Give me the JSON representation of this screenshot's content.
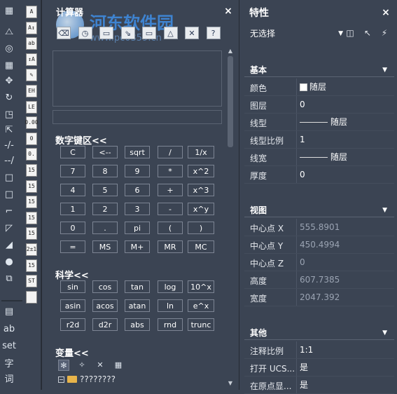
{
  "watermark": {
    "text": "河东软件园",
    "url": "www.pc0359.cn"
  },
  "toolbar_col1": [
    {
      "icon": "grid-icon",
      "glyph": "▦"
    },
    {
      "icon": "mirror-icon",
      "glyph": "⧍"
    },
    {
      "icon": "offset-icon",
      "glyph": "◎"
    },
    {
      "icon": "array-icon",
      "glyph": "▦"
    },
    {
      "icon": "move-icon",
      "glyph": "✥"
    },
    {
      "icon": "rotate-icon",
      "glyph": "↻"
    },
    {
      "icon": "scale-icon",
      "glyph": "◳"
    },
    {
      "icon": "stretch-icon",
      "glyph": "⇱"
    },
    {
      "icon": "trim-icon",
      "glyph": "-/-"
    },
    {
      "icon": "extend-icon",
      "glyph": "--/"
    },
    {
      "icon": "break-icon",
      "glyph": "□"
    },
    {
      "icon": "join-icon",
      "glyph": "□"
    },
    {
      "icon": "chamfer-icon",
      "glyph": "⌐"
    },
    {
      "icon": "fillet-icon",
      "glyph": "◸"
    },
    {
      "icon": "blend-icon",
      "glyph": "◢"
    },
    {
      "icon": "explode-icon",
      "glyph": "●"
    },
    {
      "icon": "edit-icon",
      "glyph": "⧉"
    },
    {
      "icon": "table-icon",
      "glyph": "▤"
    },
    {
      "icon": "ab-text-icon",
      "glyph": "ab"
    },
    {
      "icon": "set-icon",
      "glyph": "set"
    },
    {
      "icon": "zi-icon",
      "glyph": "字"
    },
    {
      "icon": "ci-icon",
      "glyph": "词"
    }
  ],
  "toolbar_col2": [
    {
      "icon": "text-a-icon",
      "glyph": "A"
    },
    {
      "icon": "text-a2-icon",
      "glyph": "A↕"
    },
    {
      "icon": "text-ab-icon",
      "glyph": "ab"
    },
    {
      "icon": "text-align-icon",
      "glyph": "↕A"
    },
    {
      "icon": "text-edit-icon",
      "glyph": "✎"
    },
    {
      "icon": "text-eh-icon",
      "glyph": "EH"
    },
    {
      "icon": "text-le-icon",
      "glyph": "LE"
    },
    {
      "icon": "dim-001-icon",
      "glyph": "0.00"
    },
    {
      "icon": "dim-0-icon",
      "glyph": "0"
    },
    {
      "icon": "dim-rot-icon",
      "glyph": "0."
    },
    {
      "icon": "dim-15-icon",
      "glyph": "15"
    },
    {
      "icon": "dim-15b-icon",
      "glyph": "15"
    },
    {
      "icon": "dim-15c-icon",
      "glyph": "15"
    },
    {
      "icon": "dim-15d-icon",
      "glyph": "15"
    },
    {
      "icon": "dim-15e-icon",
      "glyph": "15"
    },
    {
      "icon": "dim-21-icon",
      "glyph": "2±1"
    },
    {
      "icon": "dim-15f-icon",
      "glyph": "15"
    },
    {
      "icon": "dim-st-icon",
      "glyph": "ST"
    },
    {
      "icon": "tb2-blank-icon",
      "glyph": ""
    }
  ],
  "calculator": {
    "title": "计算器",
    "close": "×",
    "tools": [
      "clear-icon",
      "history-icon",
      "calc-distance-icon",
      "get-coordinates-icon",
      "units-icon",
      "angle-icon",
      "intersect-icon",
      "help-icon"
    ],
    "tool_glyphs": [
      "⌫",
      "◷",
      "▭",
      "⇘",
      "▭",
      "△",
      "✕",
      "?"
    ],
    "numpad_header": "数字键区<<",
    "numpad": [
      [
        "C",
        "<--",
        "sqrt",
        "/",
        "1/x"
      ],
      [
        "7",
        "8",
        "9",
        "*",
        "x^2"
      ],
      [
        "4",
        "5",
        "6",
        "+",
        "x^3"
      ],
      [
        "1",
        "2",
        "3",
        "-",
        "x^y"
      ],
      [
        "0",
        ".",
        "pi",
        "(",
        ")"
      ],
      [
        "=",
        "MS",
        "M+",
        "MR",
        "MC"
      ]
    ],
    "science_header": "科学<<",
    "science": [
      [
        "sin",
        "cos",
        "tan",
        "log",
        "10^x"
      ],
      [
        "asin",
        "acos",
        "atan",
        "ln",
        "e^x"
      ],
      [
        "r2d",
        "d2r",
        "abs",
        "rnd",
        "trunc"
      ]
    ],
    "variables_header": "变量<<",
    "var_tools": [
      "✻",
      "✧",
      "✕",
      "▦"
    ],
    "tree_item": "????????"
  },
  "properties": {
    "title": "特性",
    "close": "×",
    "selection": "无选择",
    "tools": [
      "◫",
      "↖",
      "⚡"
    ],
    "groups": [
      {
        "name": "基本",
        "rows": [
          {
            "k": "颜色",
            "v": "随层",
            "kind": "color"
          },
          {
            "k": "图层",
            "v": "0"
          },
          {
            "k": "线型",
            "v": "随层",
            "kind": "line"
          },
          {
            "k": "线型比例",
            "v": "1"
          },
          {
            "k": "线宽",
            "v": "随层",
            "kind": "line"
          },
          {
            "k": "厚度",
            "v": "0"
          }
        ]
      },
      {
        "name": "视图",
        "rows": [
          {
            "k": "中心点 X",
            "v": "555.8901",
            "dim": true
          },
          {
            "k": "中心点 Y",
            "v": "450.4994",
            "dim": true
          },
          {
            "k": "中心点 Z",
            "v": "0",
            "dim": true
          },
          {
            "k": "高度",
            "v": "607.7385",
            "dim": true
          },
          {
            "k": "宽度",
            "v": "2047.392",
            "dim": true
          }
        ]
      },
      {
        "name": "其他",
        "rows": [
          {
            "k": "注释比例",
            "v": "1:1"
          },
          {
            "k": "打开 UCS...",
            "v": "是"
          },
          {
            "k": "在原点显...",
            "v": "是"
          }
        ]
      }
    ]
  }
}
